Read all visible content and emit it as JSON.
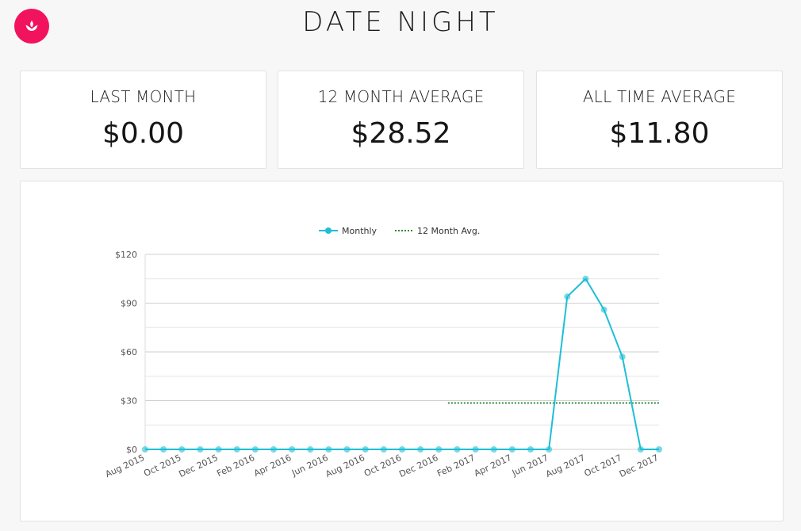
{
  "header": {
    "title": "DATE NIGHT",
    "logo_icon": "lotus-icon",
    "logo_color": "#f2135f"
  },
  "stats": [
    {
      "label": "LAST MONTH",
      "value": "$0.00"
    },
    {
      "label": "12 MONTH AVERAGE",
      "value": "$28.52"
    },
    {
      "label": "ALL TIME AVERAGE",
      "value": "$11.80"
    }
  ],
  "chart_data": {
    "type": "line",
    "categories": [
      "Aug 2015",
      "Sep 2015",
      "Oct 2015",
      "Nov 2015",
      "Dec 2015",
      "Jan 2016",
      "Feb 2016",
      "Mar 2016",
      "Apr 2016",
      "May 2016",
      "Jun 2016",
      "Jul 2016",
      "Aug 2016",
      "Sep 2016",
      "Oct 2016",
      "Nov 2016",
      "Dec 2016",
      "Jan 2017",
      "Feb 2017",
      "Mar 2017",
      "Apr 2017",
      "May 2017",
      "Jun 2017",
      "Jul 2017",
      "Aug 2017",
      "Sep 2017",
      "Oct 2017",
      "Nov 2017",
      "Dec 2017"
    ],
    "tick_labels": [
      "Aug 2015",
      "Oct 2015",
      "Dec 2015",
      "Feb 2016",
      "Apr 2016",
      "Jun 2016",
      "Aug 2016",
      "Oct 2016",
      "Dec 2016",
      "Feb 2017",
      "Apr 2017",
      "Jun 2017",
      "Aug 2017",
      "Oct 2017",
      "Dec 2017"
    ],
    "series": [
      {
        "name": "Monthly",
        "color": "#1ebfd6",
        "style": "solid-with-markers",
        "values": [
          0,
          0,
          0,
          0,
          0,
          0,
          0,
          0,
          0,
          0,
          0,
          0,
          0,
          0,
          0,
          0,
          0,
          0,
          0,
          0,
          0,
          0,
          0,
          94,
          105,
          86,
          57,
          0,
          0
        ]
      },
      {
        "name": "12 Month Avg.",
        "color": "#2e8b2e",
        "style": "dotted",
        "value": 28.52,
        "x_range": [
          "Jan 2017",
          "Dec 2017"
        ]
      }
    ],
    "ylim": [
      0,
      120
    ],
    "yticks": [
      0,
      30,
      60,
      90,
      120
    ],
    "ytick_labels": [
      "$0",
      "$30",
      "$60",
      "$90",
      "$120"
    ],
    "grid": true,
    "legend_position": "top-center"
  }
}
